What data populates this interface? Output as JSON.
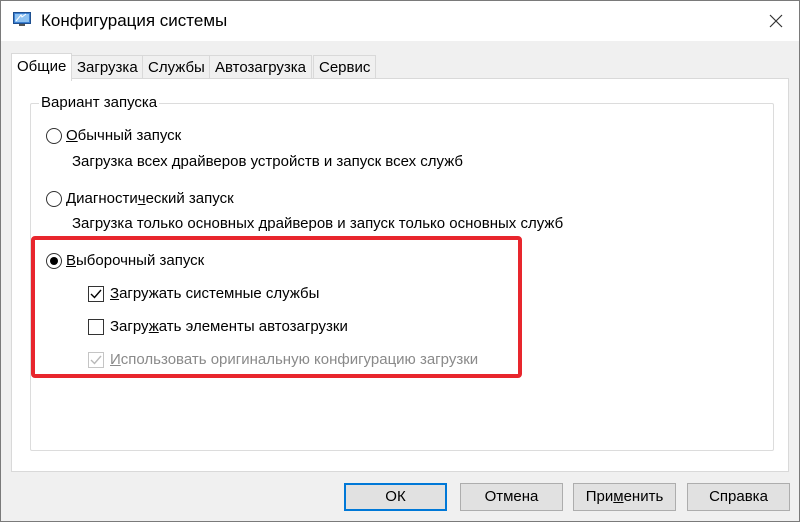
{
  "window": {
    "title": "Конфигурация системы",
    "icon": "system-config-icon"
  },
  "tabs": [
    {
      "label": "Общие",
      "active": true
    },
    {
      "label": "Загрузка",
      "active": false
    },
    {
      "label": "Службы",
      "active": false
    },
    {
      "label": "Автозагрузка",
      "active": false
    },
    {
      "label": "Сервис",
      "active": false
    }
  ],
  "group": {
    "label": "Вариант запуска",
    "options": [
      {
        "label_pre": "",
        "label_u": "О",
        "label_post": "бычный запуск",
        "desc": "Загрузка всех драйверов устройств и запуск всех служб",
        "checked": false
      },
      {
        "label_pre": "Диагности",
        "label_u": "ч",
        "label_post": "еский запуск",
        "desc": "Загрузка только основных драйверов и запуск только основных служб",
        "checked": false
      },
      {
        "label_pre": "",
        "label_u": "В",
        "label_post": "ыборочный запуск",
        "checked": true
      }
    ],
    "checkboxes": [
      {
        "label_pre": "",
        "label_u": "З",
        "label_post": "агружать системные службы",
        "checked": true,
        "disabled": false
      },
      {
        "label_pre": "Загру",
        "label_u": "ж",
        "label_post": "ать элементы автозагрузки",
        "checked": false,
        "disabled": false
      },
      {
        "label_pre": "",
        "label_u": "И",
        "label_post": "спользовать оригинальную конфигурацию загрузки",
        "checked": true,
        "disabled": true
      }
    ]
  },
  "buttons": {
    "ok": "ОК",
    "cancel": "Отмена",
    "apply_pre": "При",
    "apply_u": "м",
    "apply_post": "енить",
    "help": "Справка"
  },
  "colors": {
    "highlight": "#e8262d",
    "accent": "#0078d7"
  }
}
